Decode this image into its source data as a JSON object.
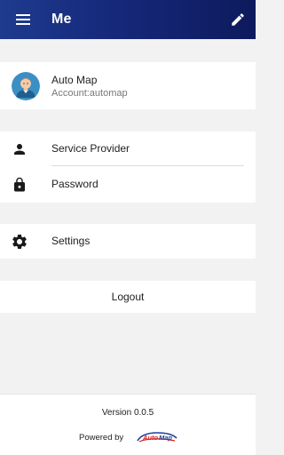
{
  "appbar": {
    "title": "Me",
    "menu_icon": "menu-icon",
    "edit_icon": "edit-icon"
  },
  "profile": {
    "name": "Auto Map",
    "account": "Account:automap",
    "avatar_icon": "avatar-icon"
  },
  "menu": {
    "items": [
      {
        "label": "Service Provider",
        "icon": "person-icon"
      },
      {
        "label": "Password",
        "icon": "lock-icon"
      }
    ],
    "settings": {
      "label": "Settings",
      "icon": "gear-icon"
    },
    "logout": "Logout"
  },
  "footer": {
    "version": "Version 0.0.5",
    "powered_by": "Powered by",
    "logo_text": "AutoMap"
  },
  "colors": {
    "appbar_start": "#1e3b8e",
    "appbar_end": "#0d1a5c",
    "background": "#f2f2f2"
  }
}
